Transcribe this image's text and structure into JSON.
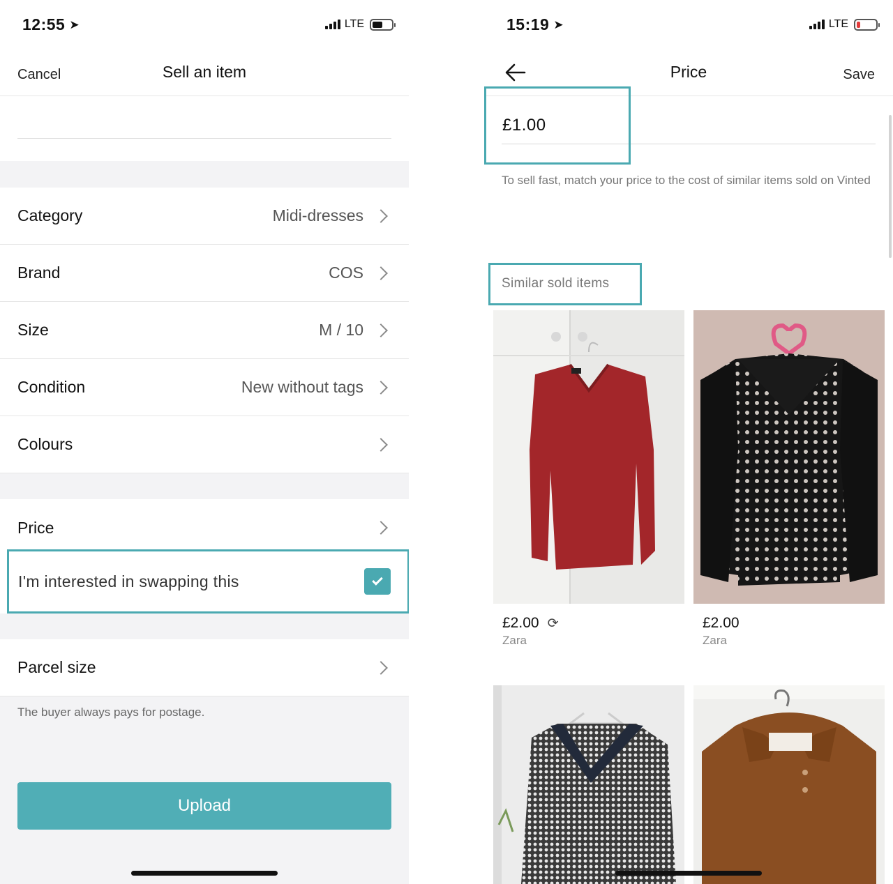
{
  "left": {
    "status": {
      "time": "12:55",
      "network": "LTE"
    },
    "nav": {
      "cancel": "Cancel",
      "title": "Sell an item"
    },
    "rows": [
      {
        "label": "Category",
        "value": "Midi-dresses"
      },
      {
        "label": "Brand",
        "value": "COS"
      },
      {
        "label": "Size",
        "value": "M / 10"
      },
      {
        "label": "Condition",
        "value": "New without tags"
      },
      {
        "label": "Colours",
        "value": ""
      }
    ],
    "price_label": "Price",
    "swap_label": "I'm interested in swapping this",
    "swap_checked": true,
    "parcel_label": "Parcel size",
    "postage_note": "The buyer always pays for postage.",
    "upload_label": "Upload"
  },
  "right": {
    "status": {
      "time": "15:19",
      "network": "LTE"
    },
    "nav": {
      "title": "Price",
      "save": "Save"
    },
    "price_value": "£1.00",
    "price_hint": "To sell fast, match your price to the cost of similar items sold on Vinted",
    "similar_label": "Similar sold items",
    "items": [
      {
        "price": "£2.00",
        "brand": "Zara",
        "swap": true,
        "desc": "red v-neck sweater"
      },
      {
        "price": "£2.00",
        "brand": "Zara",
        "swap": false,
        "desc": "black polka dot cardigan"
      },
      {
        "price": "",
        "brand": "",
        "swap": false,
        "desc": "black and white knit sweater"
      },
      {
        "price": "",
        "brand": "",
        "swap": false,
        "desc": "brown fluffy polo sweater"
      }
    ]
  },
  "colors": {
    "accent": "#4aa9b1",
    "button": "#50aeb6",
    "battery_low": "#e23b3b"
  }
}
